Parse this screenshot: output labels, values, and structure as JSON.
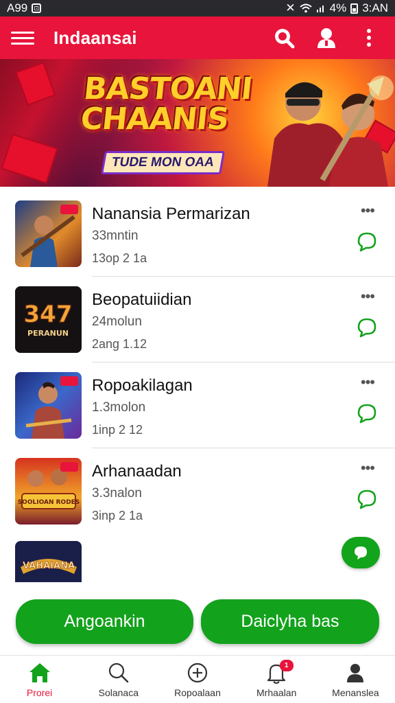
{
  "status_bar": {
    "left_text": "A99",
    "right_text": "4%",
    "time": "3:AN",
    "icons": [
      "notification-box-icon",
      "no-sound-icon",
      "wifi-icon",
      "signal-icon",
      "battery-icon"
    ]
  },
  "app_bar": {
    "title": "Indaansai",
    "background": "#e8143b",
    "actions": [
      "search-icon",
      "account-icon",
      "more-vert-icon"
    ]
  },
  "banner": {
    "title_line1": "BASTOANI",
    "title_line2": "CHAANIS",
    "tagline": "TUDE MON OAA"
  },
  "games": [
    {
      "name": "Nanansia Permarizan",
      "meta1": "33mntin",
      "meta2": "13op 2 1a"
    },
    {
      "name": "Beopatuiidian",
      "meta1": "24molun",
      "meta2": "2ang 1.12",
      "thumb_text_top": "347",
      "thumb_text_bottom": "PERANUN"
    },
    {
      "name": "Ropoakilagan",
      "meta1": "1.3molon",
      "meta2": "1inp 2 12"
    },
    {
      "name": "Arhanaadan",
      "meta1": "3.3nalon",
      "meta2": "3inp 2 1a",
      "thumb_text": "SOOLIOAN RODES"
    }
  ],
  "partial_thumb_text": "VAHAIANA",
  "buttons": {
    "left": "Angoankin",
    "right": "Daiclyha bas",
    "color": "#13a21c"
  },
  "bottom_nav": [
    {
      "label": "Prorei",
      "icon": "home-icon"
    },
    {
      "label": "Solanaca",
      "icon": "search-icon"
    },
    {
      "label": "Ropoalaan",
      "icon": "add-circle-icon"
    },
    {
      "label": "Mrhaalan",
      "icon": "bell-icon",
      "badge": "1"
    },
    {
      "label": "Menanslea",
      "icon": "person-icon"
    }
  ]
}
